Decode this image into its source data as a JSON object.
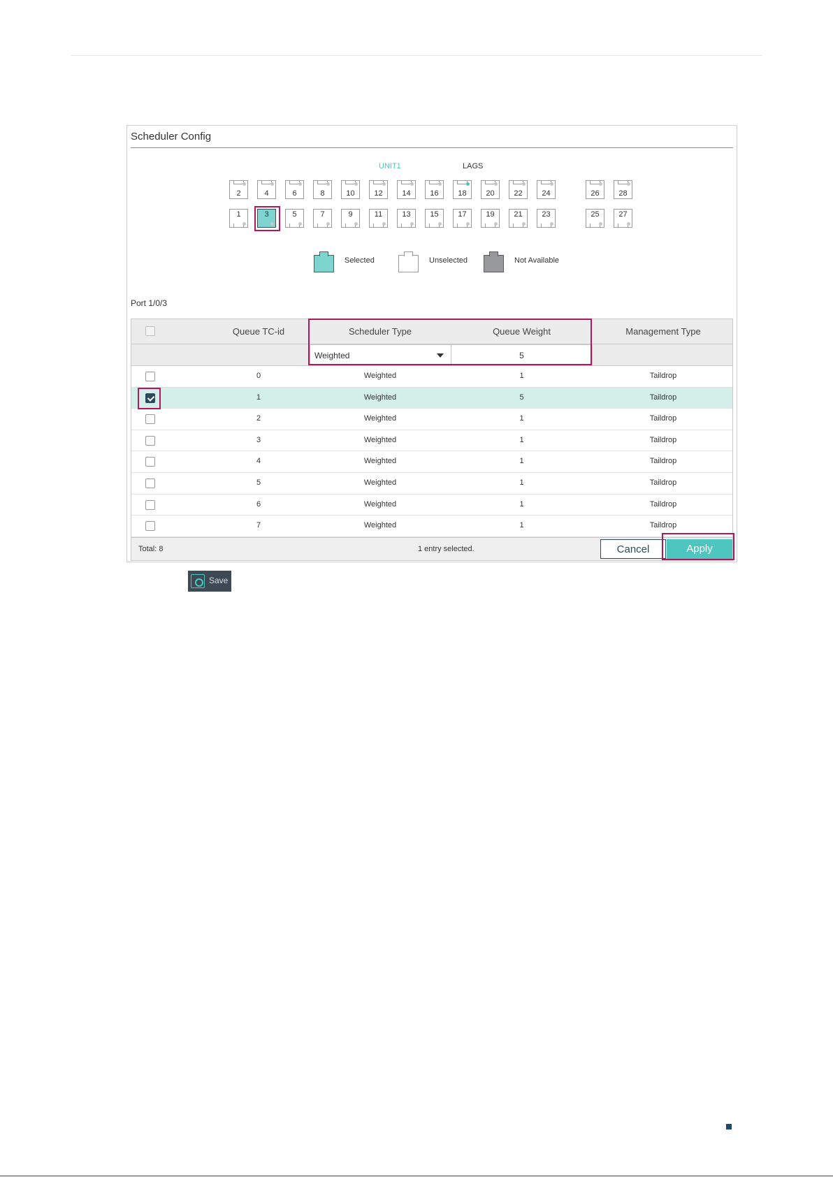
{
  "panel": {
    "title": "Scheduler Config"
  },
  "units": {
    "active": "UNIT1",
    "lags": "LAGS"
  },
  "ports": {
    "top": [
      "2",
      "4",
      "6",
      "8",
      "10",
      "12",
      "14",
      "16",
      "18",
      "20",
      "22",
      "24",
      "26",
      "28"
    ],
    "bottom": [
      "1",
      "3",
      "5",
      "7",
      "9",
      "11",
      "13",
      "15",
      "17",
      "19",
      "21",
      "23",
      "25",
      "27"
    ],
    "selected": "3",
    "active_led": "18"
  },
  "legend": {
    "selected": "Selected",
    "unselected": "Unselected",
    "not_available": "Not Available"
  },
  "port_label": "Port 1/0/3",
  "table": {
    "headers": {
      "queue": "Queue TC-id",
      "type": "Scheduler Type",
      "weight": "Queue Weight",
      "mgmt": "Management Type"
    },
    "edit": {
      "type_value": "Weighted",
      "weight_value": "5"
    },
    "rows": [
      {
        "id": "0",
        "type": "Weighted",
        "weight": "1",
        "mgmt": "Taildrop",
        "checked": false
      },
      {
        "id": "1",
        "type": "Weighted",
        "weight": "5",
        "mgmt": "Taildrop",
        "checked": true
      },
      {
        "id": "2",
        "type": "Weighted",
        "weight": "1",
        "mgmt": "Taildrop",
        "checked": false
      },
      {
        "id": "3",
        "type": "Weighted",
        "weight": "1",
        "mgmt": "Taildrop",
        "checked": false
      },
      {
        "id": "4",
        "type": "Weighted",
        "weight": "1",
        "mgmt": "Taildrop",
        "checked": false
      },
      {
        "id": "5",
        "type": "Weighted",
        "weight": "1",
        "mgmt": "Taildrop",
        "checked": false
      },
      {
        "id": "6",
        "type": "Weighted",
        "weight": "1",
        "mgmt": "Taildrop",
        "checked": false
      },
      {
        "id": "7",
        "type": "Weighted",
        "weight": "1",
        "mgmt": "Taildrop",
        "checked": false
      }
    ],
    "footer": {
      "total": "Total: 8",
      "selected_info": "1 entry selected.",
      "cancel": "Cancel",
      "apply": "Apply"
    }
  },
  "save_button": {
    "label": "Save",
    "icon": "save-gear-icon"
  },
  "colors": {
    "accent": "#4ec6c0",
    "highlight": "#b0175f",
    "dark": "#2b4a5e",
    "selected_row": "#d4efe9"
  }
}
